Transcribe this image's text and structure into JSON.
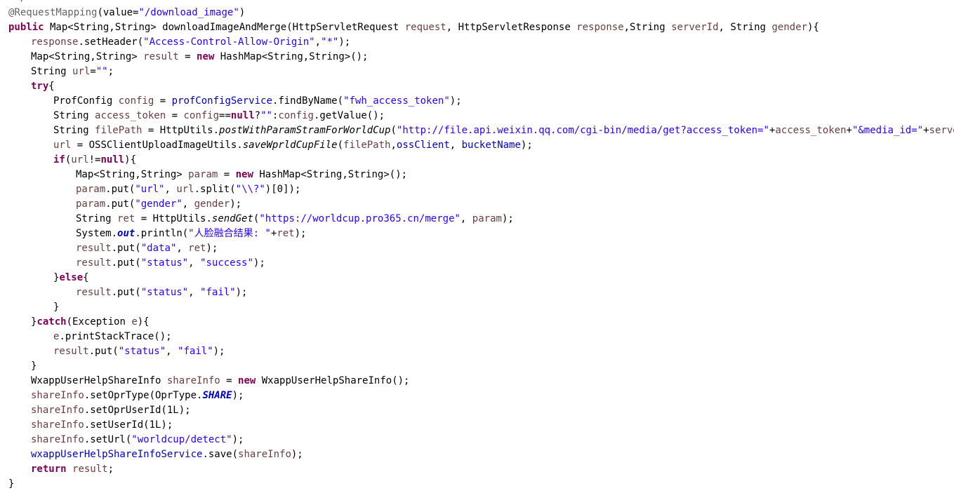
{
  "editor": {
    "colors": {
      "background": "#ffffff",
      "keyword": "#7f0055",
      "string": "#2a00ff",
      "annotation": "#646464",
      "field": "#0000c0",
      "local_variable": "#6a3e3e",
      "comment": "#3f5fbf",
      "default": "#000000"
    },
    "indent_unit": 4,
    "lines": [
      {
        "indent": 0,
        "partial": true,
        "tokens": [
          {
            "t": "comment",
            "v": " */"
          }
        ]
      },
      {
        "indent": 0,
        "tokens": [
          {
            "t": "ann",
            "v": "@RequestMapping"
          },
          {
            "t": "plain",
            "v": "(value="
          },
          {
            "t": "str",
            "v": "\"/download_image\""
          },
          {
            "t": "plain",
            "v": ")"
          }
        ]
      },
      {
        "indent": 0,
        "tokens": [
          {
            "t": "kw",
            "v": "public"
          },
          {
            "t": "plain",
            "v": " Map<String,String> downloadImageAndMerge(HttpServletRequest "
          },
          {
            "t": "param",
            "v": "request"
          },
          {
            "t": "plain",
            "v": ", HttpServletResponse "
          },
          {
            "t": "param",
            "v": "response"
          },
          {
            "t": "plain",
            "v": ",String "
          },
          {
            "t": "param",
            "v": "serverId"
          },
          {
            "t": "plain",
            "v": ", String "
          },
          {
            "t": "param",
            "v": "gender"
          },
          {
            "t": "plain",
            "v": "){"
          }
        ]
      },
      {
        "indent": 1,
        "tokens": [
          {
            "t": "param",
            "v": "response"
          },
          {
            "t": "plain",
            "v": ".setHeader("
          },
          {
            "t": "str",
            "v": "\"Access-Control-Allow-Origin\""
          },
          {
            "t": "plain",
            "v": ","
          },
          {
            "t": "str",
            "v": "\"*\""
          },
          {
            "t": "plain",
            "v": ");"
          }
        ]
      },
      {
        "indent": 1,
        "tokens": [
          {
            "t": "plain",
            "v": "Map<String,String> "
          },
          {
            "t": "param",
            "v": "result"
          },
          {
            "t": "plain",
            "v": " = "
          },
          {
            "t": "kw",
            "v": "new"
          },
          {
            "t": "plain",
            "v": " HashMap<String,String>();"
          }
        ]
      },
      {
        "indent": 1,
        "tokens": [
          {
            "t": "plain",
            "v": "String "
          },
          {
            "t": "param",
            "v": "url"
          },
          {
            "t": "plain",
            "v": "="
          },
          {
            "t": "str",
            "v": "\"\""
          },
          {
            "t": "plain",
            "v": ";"
          }
        ]
      },
      {
        "indent": 1,
        "tokens": [
          {
            "t": "kw",
            "v": "try"
          },
          {
            "t": "plain",
            "v": "{"
          }
        ]
      },
      {
        "indent": 2,
        "tokens": [
          {
            "t": "plain",
            "v": "ProfConfig "
          },
          {
            "t": "param",
            "v": "config"
          },
          {
            "t": "plain",
            "v": " = "
          },
          {
            "t": "field",
            "v": "profConfigService"
          },
          {
            "t": "plain",
            "v": ".findByName("
          },
          {
            "t": "str",
            "v": "\"fwh_access_token\""
          },
          {
            "t": "plain",
            "v": ");"
          }
        ]
      },
      {
        "indent": 2,
        "tokens": [
          {
            "t": "plain",
            "v": "String "
          },
          {
            "t": "param",
            "v": "access_token"
          },
          {
            "t": "plain",
            "v": " = "
          },
          {
            "t": "param",
            "v": "config"
          },
          {
            "t": "plain",
            "v": "=="
          },
          {
            "t": "kw",
            "v": "null"
          },
          {
            "t": "plain",
            "v": "?"
          },
          {
            "t": "str",
            "v": "\"\""
          },
          {
            "t": "plain",
            "v": ":"
          },
          {
            "t": "param",
            "v": "config"
          },
          {
            "t": "plain",
            "v": ".getValue();"
          }
        ]
      },
      {
        "indent": 2,
        "tokens": [
          {
            "t": "plain",
            "v": "String "
          },
          {
            "t": "param",
            "v": "filePath"
          },
          {
            "t": "plain",
            "v": " = HttpUtils."
          },
          {
            "t": "static",
            "v": "postWithParamStramForWorldCup"
          },
          {
            "t": "plain",
            "v": "("
          },
          {
            "t": "str",
            "v": "\"http://file.api.weixin.qq.com/cgi-bin/media/get?access_token=\""
          },
          {
            "t": "plain",
            "v": "+"
          },
          {
            "t": "param",
            "v": "access_token"
          },
          {
            "t": "plain",
            "v": "+"
          },
          {
            "t": "str",
            "v": "\"&media_id=\""
          },
          {
            "t": "plain",
            "v": "+"
          },
          {
            "t": "param",
            "v": "serverId"
          },
          {
            "t": "plain",
            "v": ", "
          },
          {
            "t": "str",
            "v": "\"\""
          }
        ]
      },
      {
        "indent": 2,
        "tokens": [
          {
            "t": "param",
            "v": "url"
          },
          {
            "t": "plain",
            "v": " = OSSClientUploadImageUtils."
          },
          {
            "t": "static",
            "v": "saveWprldCupFile"
          },
          {
            "t": "plain",
            "v": "("
          },
          {
            "t": "param",
            "v": "filePath"
          },
          {
            "t": "plain",
            "v": ","
          },
          {
            "t": "field",
            "v": "ossClient"
          },
          {
            "t": "plain",
            "v": ", "
          },
          {
            "t": "field",
            "v": "bucketName"
          },
          {
            "t": "plain",
            "v": ");"
          }
        ]
      },
      {
        "indent": 2,
        "tokens": [
          {
            "t": "kw",
            "v": "if"
          },
          {
            "t": "plain",
            "v": "("
          },
          {
            "t": "param",
            "v": "url"
          },
          {
            "t": "plain",
            "v": "!="
          },
          {
            "t": "kw",
            "v": "null"
          },
          {
            "t": "plain",
            "v": "){"
          }
        ]
      },
      {
        "indent": 3,
        "tokens": [
          {
            "t": "plain",
            "v": "Map<String,String> "
          },
          {
            "t": "param",
            "v": "param"
          },
          {
            "t": "plain",
            "v": " = "
          },
          {
            "t": "kw",
            "v": "new"
          },
          {
            "t": "plain",
            "v": " HashMap<String,String>();"
          }
        ]
      },
      {
        "indent": 3,
        "tokens": [
          {
            "t": "param",
            "v": "param"
          },
          {
            "t": "plain",
            "v": ".put("
          },
          {
            "t": "str",
            "v": "\"url\""
          },
          {
            "t": "plain",
            "v": ", "
          },
          {
            "t": "param",
            "v": "url"
          },
          {
            "t": "plain",
            "v": ".split("
          },
          {
            "t": "str",
            "v": "\"\\\\?\""
          },
          {
            "t": "plain",
            "v": ")[0]);"
          }
        ]
      },
      {
        "indent": 3,
        "tokens": [
          {
            "t": "param",
            "v": "param"
          },
          {
            "t": "plain",
            "v": ".put("
          },
          {
            "t": "str",
            "v": "\"gender\""
          },
          {
            "t": "plain",
            "v": ", "
          },
          {
            "t": "param",
            "v": "gender"
          },
          {
            "t": "plain",
            "v": ");"
          }
        ]
      },
      {
        "indent": 3,
        "tokens": [
          {
            "t": "plain",
            "v": "String "
          },
          {
            "t": "param",
            "v": "ret"
          },
          {
            "t": "plain",
            "v": " = HttpUtils."
          },
          {
            "t": "static",
            "v": "sendGet"
          },
          {
            "t": "plain",
            "v": "("
          },
          {
            "t": "str",
            "v": "\"https://worldcup.pro365.cn/merge\""
          },
          {
            "t": "plain",
            "v": ", "
          },
          {
            "t": "param",
            "v": "param"
          },
          {
            "t": "plain",
            "v": ");"
          }
        ]
      },
      {
        "indent": 3,
        "tokens": [
          {
            "t": "plain",
            "v": "System."
          },
          {
            "t": "sfield",
            "v": "out"
          },
          {
            "t": "plain",
            "v": ".println("
          },
          {
            "t": "str",
            "v": "\"人脸融合结果: \""
          },
          {
            "t": "plain",
            "v": "+"
          },
          {
            "t": "param",
            "v": "ret"
          },
          {
            "t": "plain",
            "v": ");"
          }
        ]
      },
      {
        "indent": 3,
        "tokens": [
          {
            "t": "param",
            "v": "result"
          },
          {
            "t": "plain",
            "v": ".put("
          },
          {
            "t": "str",
            "v": "\"data\""
          },
          {
            "t": "plain",
            "v": ", "
          },
          {
            "t": "param",
            "v": "ret"
          },
          {
            "t": "plain",
            "v": ");"
          }
        ]
      },
      {
        "indent": 3,
        "tokens": [
          {
            "t": "param",
            "v": "result"
          },
          {
            "t": "plain",
            "v": ".put("
          },
          {
            "t": "str",
            "v": "\"status\""
          },
          {
            "t": "plain",
            "v": ", "
          },
          {
            "t": "str",
            "v": "\"success\""
          },
          {
            "t": "plain",
            "v": ");"
          }
        ]
      },
      {
        "indent": 2,
        "tokens": [
          {
            "t": "plain",
            "v": "}"
          },
          {
            "t": "kw",
            "v": "else"
          },
          {
            "t": "plain",
            "v": "{"
          }
        ]
      },
      {
        "indent": 3,
        "tokens": [
          {
            "t": "param",
            "v": "result"
          },
          {
            "t": "plain",
            "v": ".put("
          },
          {
            "t": "str",
            "v": "\"status\""
          },
          {
            "t": "plain",
            "v": ", "
          },
          {
            "t": "str",
            "v": "\"fail\""
          },
          {
            "t": "plain",
            "v": ");"
          }
        ]
      },
      {
        "indent": 2,
        "tokens": [
          {
            "t": "plain",
            "v": "}"
          }
        ]
      },
      {
        "indent": 1,
        "tokens": [
          {
            "t": "plain",
            "v": "}"
          },
          {
            "t": "kw",
            "v": "catch"
          },
          {
            "t": "plain",
            "v": "(Exception "
          },
          {
            "t": "param",
            "v": "e"
          },
          {
            "t": "plain",
            "v": "){"
          }
        ]
      },
      {
        "indent": 2,
        "tokens": [
          {
            "t": "param",
            "v": "e"
          },
          {
            "t": "plain",
            "v": ".printStackTrace();"
          }
        ]
      },
      {
        "indent": 2,
        "tokens": [
          {
            "t": "param",
            "v": "result"
          },
          {
            "t": "plain",
            "v": ".put("
          },
          {
            "t": "str",
            "v": "\"status\""
          },
          {
            "t": "plain",
            "v": ", "
          },
          {
            "t": "str",
            "v": "\"fail\""
          },
          {
            "t": "plain",
            "v": ");"
          }
        ]
      },
      {
        "indent": 1,
        "tokens": [
          {
            "t": "plain",
            "v": "}"
          }
        ]
      },
      {
        "indent": 1,
        "tokens": [
          {
            "t": "plain",
            "v": "WxappUserHelpShareInfo "
          },
          {
            "t": "param",
            "v": "shareInfo"
          },
          {
            "t": "plain",
            "v": " = "
          },
          {
            "t": "kw",
            "v": "new"
          },
          {
            "t": "plain",
            "v": " WxappUserHelpShareInfo();"
          }
        ]
      },
      {
        "indent": 1,
        "tokens": [
          {
            "t": "param",
            "v": "shareInfo"
          },
          {
            "t": "plain",
            "v": ".setOprType(OprType."
          },
          {
            "t": "sfield",
            "v": "SHARE"
          },
          {
            "t": "plain",
            "v": ");"
          }
        ]
      },
      {
        "indent": 1,
        "tokens": [
          {
            "t": "param",
            "v": "shareInfo"
          },
          {
            "t": "plain",
            "v": ".setOprUserId(1L);"
          }
        ]
      },
      {
        "indent": 1,
        "tokens": [
          {
            "t": "param",
            "v": "shareInfo"
          },
          {
            "t": "plain",
            "v": ".setUserId(1L);"
          }
        ]
      },
      {
        "indent": 1,
        "tokens": [
          {
            "t": "param",
            "v": "shareInfo"
          },
          {
            "t": "plain",
            "v": ".setUrl("
          },
          {
            "t": "str",
            "v": "\"worldcup/detect\""
          },
          {
            "t": "plain",
            "v": ");"
          }
        ]
      },
      {
        "indent": 1,
        "tokens": [
          {
            "t": "field",
            "v": "wxappUserHelpShareInfoService"
          },
          {
            "t": "plain",
            "v": ".save("
          },
          {
            "t": "param",
            "v": "shareInfo"
          },
          {
            "t": "plain",
            "v": ");"
          }
        ]
      },
      {
        "indent": 1,
        "tokens": [
          {
            "t": "kw",
            "v": "return"
          },
          {
            "t": "plain",
            "v": " "
          },
          {
            "t": "param",
            "v": "result"
          },
          {
            "t": "plain",
            "v": ";"
          }
        ]
      },
      {
        "indent": 0,
        "tokens": [
          {
            "t": "plain",
            "v": "}"
          }
        ]
      }
    ]
  }
}
